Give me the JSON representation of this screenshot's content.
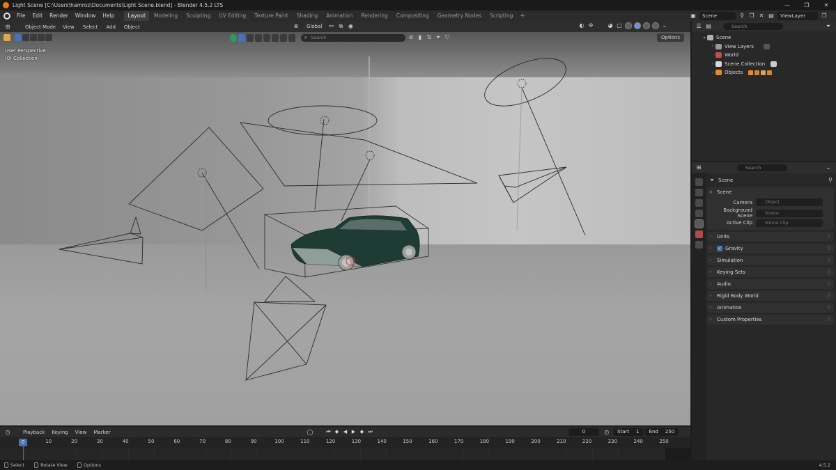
{
  "window": {
    "title": "Light Scene [C:\\Users\\hamroz\\Documents\\Light Scene.blend] - Blender 4.5.2 LTS",
    "controls": [
      "—",
      "❐",
      "✕"
    ]
  },
  "menu": [
    "File",
    "Edit",
    "Render",
    "Window",
    "Help"
  ],
  "workspaces": [
    {
      "label": "Layout",
      "active": true
    },
    {
      "label": "Modeling"
    },
    {
      "label": "Sculpting"
    },
    {
      "label": "UV Editing"
    },
    {
      "label": "Texture Paint"
    },
    {
      "label": "Shading"
    },
    {
      "label": "Animation"
    },
    {
      "label": "Rendering"
    },
    {
      "label": "Compositing"
    },
    {
      "label": "Geometry Nodes"
    },
    {
      "label": "Scripting"
    }
  ],
  "workspace_add": "+",
  "scene_name": "Scene",
  "view_layer_name": "ViewLayer",
  "viewport": {
    "mode": "Object Mode",
    "menus": [
      "View",
      "Select",
      "Add",
      "Object"
    ],
    "orientation": "Global",
    "search_placeholder": "Search",
    "options_label": "Options",
    "perspective_label": "User Perspective",
    "collection_label": "(0) Collection"
  },
  "outliner": {
    "search_placeholder": "Search",
    "rows": [
      {
        "label": "Scene",
        "depth": 0,
        "expanded": true,
        "icon_color": "#b0b0b0"
      },
      {
        "label": "View Layers",
        "depth": 1,
        "icon_color": "#9a9a9a"
      },
      {
        "label": "World",
        "depth": 1,
        "icon_color": "#c04f4f"
      },
      {
        "label": "Scene Collection",
        "depth": 1,
        "icon_color": "#d8d8d8"
      },
      {
        "label": "Objects",
        "depth": 1,
        "icon_color": "#e38a2b"
      }
    ]
  },
  "properties": {
    "search_placeholder": "Search",
    "breadcrumb": "Scene",
    "scene_panel": {
      "title": "Scene",
      "fields": [
        {
          "label": "Camera",
          "placeholder": "Object"
        },
        {
          "label": "Background Scene",
          "placeholder": "Scene"
        },
        {
          "label": "Active Clip",
          "placeholder": "Movie Clip"
        }
      ]
    },
    "panels": [
      {
        "title": "Units"
      },
      {
        "title": "Gravity",
        "checkbox": true
      },
      {
        "title": "Simulation"
      },
      {
        "title": "Keying Sets"
      },
      {
        "title": "Audio"
      },
      {
        "title": "Rigid Body World"
      },
      {
        "title": "Animation"
      },
      {
        "title": "Custom Properties"
      }
    ]
  },
  "timeline": {
    "menus": [
      "Playback",
      "Keying",
      "View",
      "Marker"
    ],
    "current_frame": "0",
    "start_label": "Start",
    "start_value": "1",
    "end_label": "End",
    "end_value": "250",
    "ticks": [
      "0",
      "10",
      "20",
      "30",
      "40",
      "50",
      "60",
      "70",
      "80",
      "90",
      "100",
      "110",
      "120",
      "130",
      "140",
      "150",
      "160",
      "170",
      "180",
      "190",
      "200",
      "210",
      "220",
      "230",
      "240",
      "250"
    ],
    "current_frame_value": 0
  },
  "statusbar": {
    "items": [
      "Select",
      "Rotate View",
      "Options"
    ],
    "version": "4.5.2"
  },
  "colors": {
    "accent": "#4772b3",
    "car_body": "#1e3c33",
    "blender_orange": "#e87d0d"
  }
}
